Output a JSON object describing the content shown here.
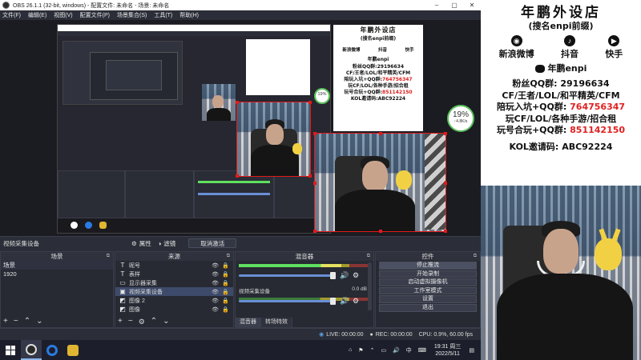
{
  "window": {
    "title": "OBS 26.1.1 (32-bit, windows) - 配置文件: 未命名 - 场景: 未命名",
    "minimize_icon": "–",
    "maximize_icon": "▢",
    "close_icon": "✕"
  },
  "menu": [
    "文件(F)",
    "编辑(E)",
    "视图(V)",
    "配置文件(P)",
    "场景集合(S)",
    "工具(T)",
    "帮助(H)"
  ],
  "source_toolbar": {
    "current_source": "视频采集设备",
    "properties_label": "属性",
    "filters_label": "滤镜",
    "deactivate_label": "取消激活"
  },
  "scenes_dock": {
    "title": "场景",
    "items": [
      "场景",
      "1920"
    ]
  },
  "sources_dock": {
    "title": "来源",
    "items": [
      {
        "icon": "T",
        "name": "昵号"
      },
      {
        "icon": "T",
        "name": "表样"
      },
      {
        "icon": "▭",
        "name": "显示器采集"
      },
      {
        "icon": "▣",
        "name": "视频采集设备"
      },
      {
        "icon": "◩",
        "name": "图像 2"
      },
      {
        "icon": "◩",
        "name": "图像"
      }
    ]
  },
  "mixer_dock": {
    "title": "混音器",
    "channels": [
      {
        "name": "",
        "db": "",
        "level": 0.78
      },
      {
        "name": "视频采集设备",
        "db": "0.0 dB",
        "level": 0.0
      }
    ],
    "tabs": [
      "混音器",
      "转场特效"
    ]
  },
  "controls_dock": {
    "title": "控件",
    "buttons": [
      "停止推流",
      "开始录制",
      "启动虚拟摄像机",
      "工作室模式",
      "设置",
      "退出"
    ]
  },
  "status": {
    "live": "LIVE: 00:00:00",
    "rec": "REC: 00:00:00",
    "cpu": "CPU: 0.9%, 60.00 fps"
  },
  "taskbar": {
    "clock_time": "19:31 周三",
    "clock_date": "2022/5/11",
    "ime": "中",
    "notif_icon": "▤"
  },
  "overlay": {
    "title": "年鹏外设店",
    "subtitle": "(搜名enpi前缀)",
    "social": [
      {
        "icon": "weibo-icon",
        "glyph": "◉",
        "label": "新浪微博"
      },
      {
        "icon": "douyin-icon",
        "glyph": "♪",
        "label": "抖音"
      },
      {
        "icon": "kuaishou-icon",
        "glyph": "▶",
        "label": "快手"
      }
    ],
    "brand": "年鹏enpi",
    "qq_group_label": "粉丝QQ群:",
    "qq_group": "29196634",
    "games_line": "CF/王者/LOL/和平精英/CFM",
    "group1_label": "陪玩入坑+QQ群:",
    "group1": "764756347",
    "games_line2": "玩CF/LOL/各种手游/招合租",
    "group2_label": "玩号合玩+QQ群:",
    "group2": "851142150",
    "kol_label": "KOL邀请码:",
    "kol_code": "ABC92224"
  },
  "badge": {
    "percent": "19%",
    "speed": "↑4.8K/s"
  },
  "colors": {
    "selection": "#e21a1a",
    "accent_red": "#e02020",
    "badge_ring": "#5bbf5b"
  }
}
